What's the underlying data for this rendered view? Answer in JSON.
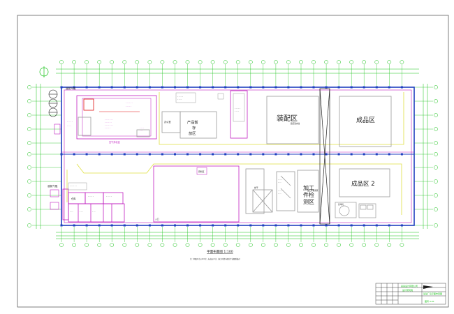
{
  "colors": {
    "paper": "#ffffff",
    "frame": "#606060",
    "wall": "#1f3fbf",
    "dim": "#16c216",
    "magenta": "#c01fc0",
    "yellow": "#e0e040",
    "equip": "#9a9a9a",
    "red": "#e01010",
    "text": "#202020"
  },
  "plan": {
    "title": "平面布置图 1:100",
    "zones": {
      "assembly": "装配区",
      "finished": "成品区",
      "finished2": "成品区 2",
      "inspect": [
        "加工",
        "件检",
        "测区"
      ],
      "product": [
        "产品暂",
        "存",
        "放区"
      ]
    },
    "gas_upper": "液氮气瓶",
    "gas_lower": "液氮气瓶",
    "small_labels": {
      "purify": "空气净化区",
      "office": "办公室",
      "dry": "烘干",
      "warehouse": "仓库",
      "material": "原料区",
      "entry": "入口",
      "lift": "升降机"
    },
    "tag_assembly": "装配流水线",
    "tag_finished2": "加工件检测区",
    "notes": "注：本图尺寸以mm计，标高以m计，施工时请与相关专业图纸核对"
  },
  "title_block": {
    "company": [
      "某某设计有限公司",
      "设计研究院"
    ],
    "drawing": "某某厂房平面布置图",
    "code": "图号 A-01"
  }
}
